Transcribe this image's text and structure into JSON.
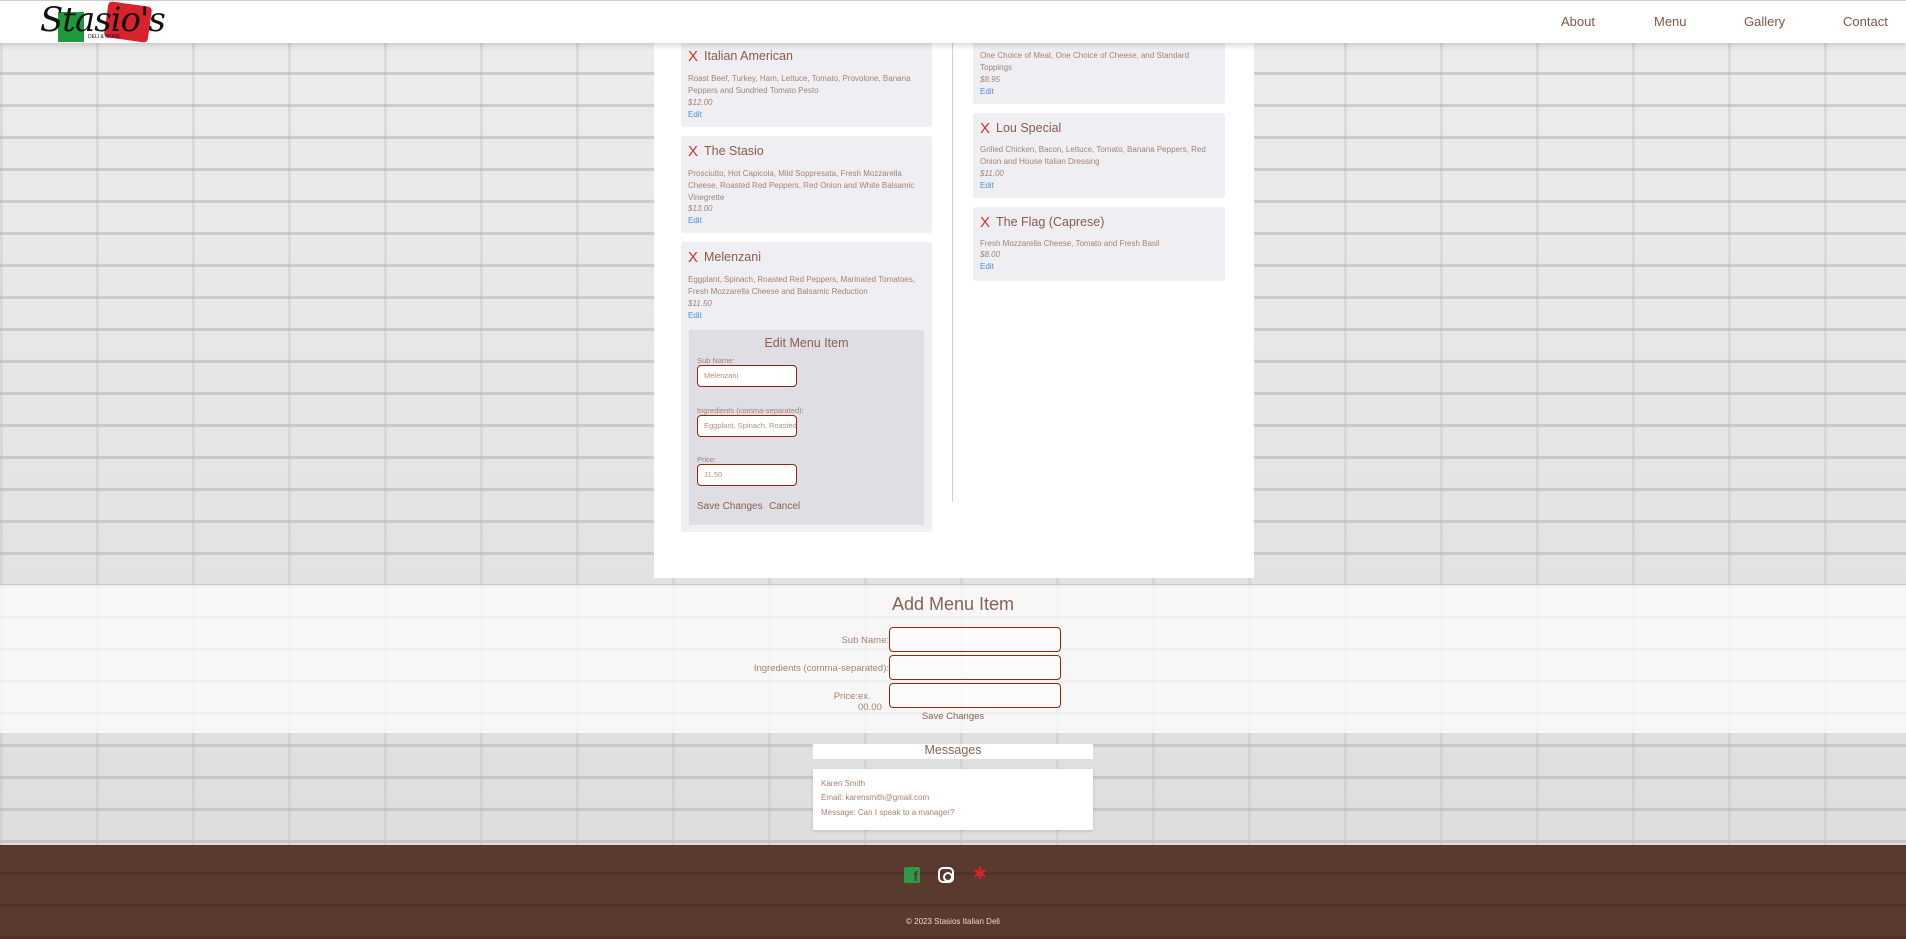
{
  "brand": {
    "logo_script": "Stasio's",
    "logo_sub": "DELI & MORE"
  },
  "nav": [
    "About",
    "Menu",
    "Gallery",
    "Contact"
  ],
  "menu_left": [
    {
      "name": "Italian American",
      "desc": "Roast Beef, Turkey, Ham, Lettuce, Tomato, Provolone, Banana Peppers and Sundried Tomato Pesto",
      "price": "$12.00",
      "edit": "Edit"
    },
    {
      "name": "The Stasio",
      "desc": "Prosciutto, Hot Capicola, Mild Soppresata, Fresh Mozzarella Cheese, Roasted Red Peppers, Red Onion and White Balsamic Vinegrette",
      "price": "$13.00",
      "edit": "Edit"
    },
    {
      "name": "Melenzani",
      "desc": "Eggplant, Spinach, Roasted Red Peppers, Marinated Tomatoes, Fresh Mozzarella Cheese and Balsamic Reduction",
      "price": "$11.50",
      "edit": "Edit"
    }
  ],
  "menu_right": [
    {
      "name": "",
      "desc": "One Choice of Meat, One Choice of Cheese, and Standard Toppings",
      "price": "$8.95",
      "edit": "Edit"
    },
    {
      "name": "Lou Special",
      "desc": "Grilled Chicken, Bacon, Lettuce, Tomato, Banana Peppers, Red Onion and House Italian Dressing",
      "price": "$11.00",
      "edit": "Edit"
    },
    {
      "name": "The Flag (Caprese)",
      "desc": "Fresh Mozzarella Cheese, Tomato and Fresh Basil",
      "price": "$8.00",
      "edit": "Edit"
    }
  ],
  "delete_glyph": "X",
  "edit_form": {
    "title": "Edit Menu Item",
    "sub_label": "Sub Name:",
    "sub_value": "Melenzani",
    "ingredients_label": "Ingredients (comma-separated):",
    "ingredients_value": "Eggplant, Spinach, Roasted Red Peppers",
    "price_label": "Price:",
    "price_value": "11.50",
    "save": "Save Changes",
    "cancel": "Cancel"
  },
  "add_form": {
    "title": "Add Menu Item",
    "sub_label": "Sub Name:",
    "ingredients_label": "Ingredients (comma-separated):",
    "price_label": "Price:",
    "price_placeholder": "ex. 00.00",
    "save": "Save Changes"
  },
  "messages": {
    "title": "Messages",
    "name": "Karen Smith",
    "email": "Email: karensmith@gmail.com",
    "message": "Message: Can I speak to a manager?"
  },
  "footer": {
    "copyright": "© 2023 Stasios Italian Deli",
    "icons": [
      "facebook-icon",
      "instagram-icon",
      "yelp-icon"
    ],
    "colors": {
      "facebook": "#2e9a45",
      "yelp": "#d8232f",
      "background": "#5a3a2e"
    }
  }
}
